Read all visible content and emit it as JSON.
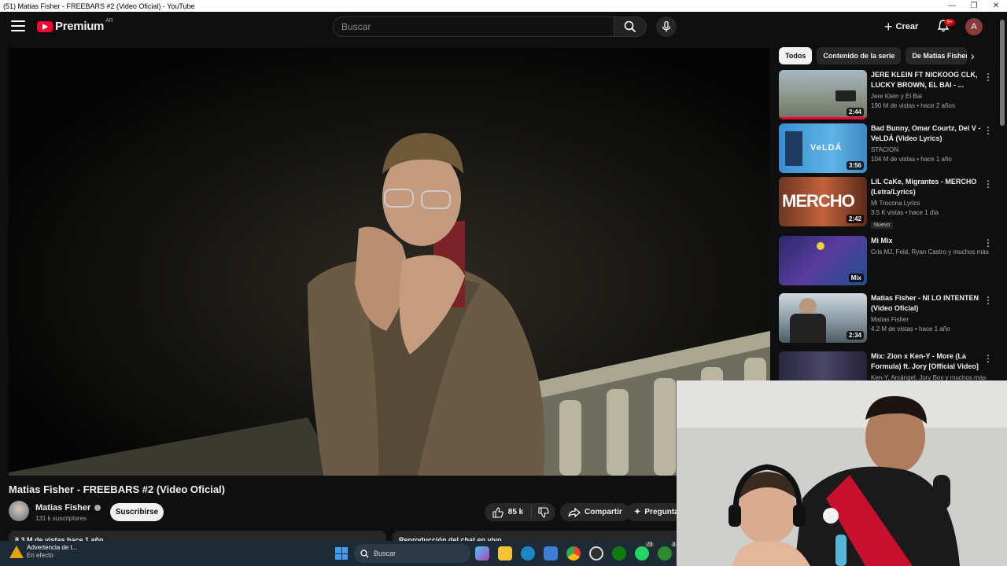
{
  "window": {
    "title": "(51) Matias Fisher - FREEBARS #2 (Video Oficial) - YouTube",
    "controls": [
      "—",
      "❐",
      "✕"
    ]
  },
  "header": {
    "logo_word": "Premium",
    "country_code": "AR",
    "search_placeholder": "Buscar",
    "create_label": "Crear",
    "notifications_badge": "9+",
    "avatar_letter": "A"
  },
  "video": {
    "title": "Matias Fisher - FREEBARS #2 (Video Oficial)",
    "channel": "Matias Fisher",
    "subscribers": "131 k suscriptores",
    "subscribe_label": "Suscribirse",
    "likes": "85 k",
    "share_label": "Compartir",
    "ask_label": "Pregunta",
    "description_preview": "8,3 M de vistas  hace 1 año",
    "chat_preview": "Reproducción del chat en vivo"
  },
  "chips": [
    "Todos",
    "Contenido de la serie",
    "De Matias Fisher"
  ],
  "recommendations": [
    {
      "title": "JERE KLEIN FT NICKOOG CLK, LUCKY BROWN, EL BAI - ...",
      "channel": "Jere Klein  y El Bai",
      "meta": "190 M de vistas • hace 2 años",
      "duration": "2:44",
      "badge": "",
      "thumb_color": "#7f8a7a"
    },
    {
      "title": "Bad Bunny, Omar Courtz, Dei V - VeLDÁ  (Video Lyrics)",
      "channel": "STACION",
      "meta": "104 M de vistas • hace 1 año",
      "duration": "3:56",
      "badge": "",
      "thumb_color": "#4aa3d8"
    },
    {
      "title": "LiL CaKe, Migrantes - MERCHO (Letra/Lyrics)",
      "channel": "Mi Trocona Lyrics",
      "meta": "3.5 K vistas • hace 1 día",
      "duration": "2:42",
      "badge": "Nuevo",
      "thumb_color": "#b45a3c"
    },
    {
      "title": "Mi Mix",
      "channel": "Cris MJ, Feid, Ryan Castro y muchos más",
      "meta": "",
      "duration": "Mix",
      "badge": "",
      "thumb_color": "#4b3c8c"
    },
    {
      "title": "Matias Fisher - NI LO INTENTEN (Video Oficial)",
      "channel": "Matias Fisher ",
      "meta": "4.2 M de vistas • hace 1 año",
      "duration": "2:34",
      "badge": "",
      "thumb_color": "#8a9aa6"
    },
    {
      "title": "Mix: Zion x Ken-Y - More (La Formula) ft. Jory [Official Video]",
      "channel": "Ken-Y, Arcángel, Jory Boy y muchos más",
      "meta": "",
      "duration": "",
      "badge": "",
      "thumb_color": "#3c3a5a"
    }
  ],
  "taskbar": {
    "alert_title": "Advertencia de t...",
    "alert_sub": "En efecto",
    "search_label": "Buscar",
    "badge_a": "73",
    "badge_b": "3"
  },
  "colors": {
    "brand_red": "#ff0033",
    "background": "#0f0f0f",
    "surface": "#272727"
  }
}
